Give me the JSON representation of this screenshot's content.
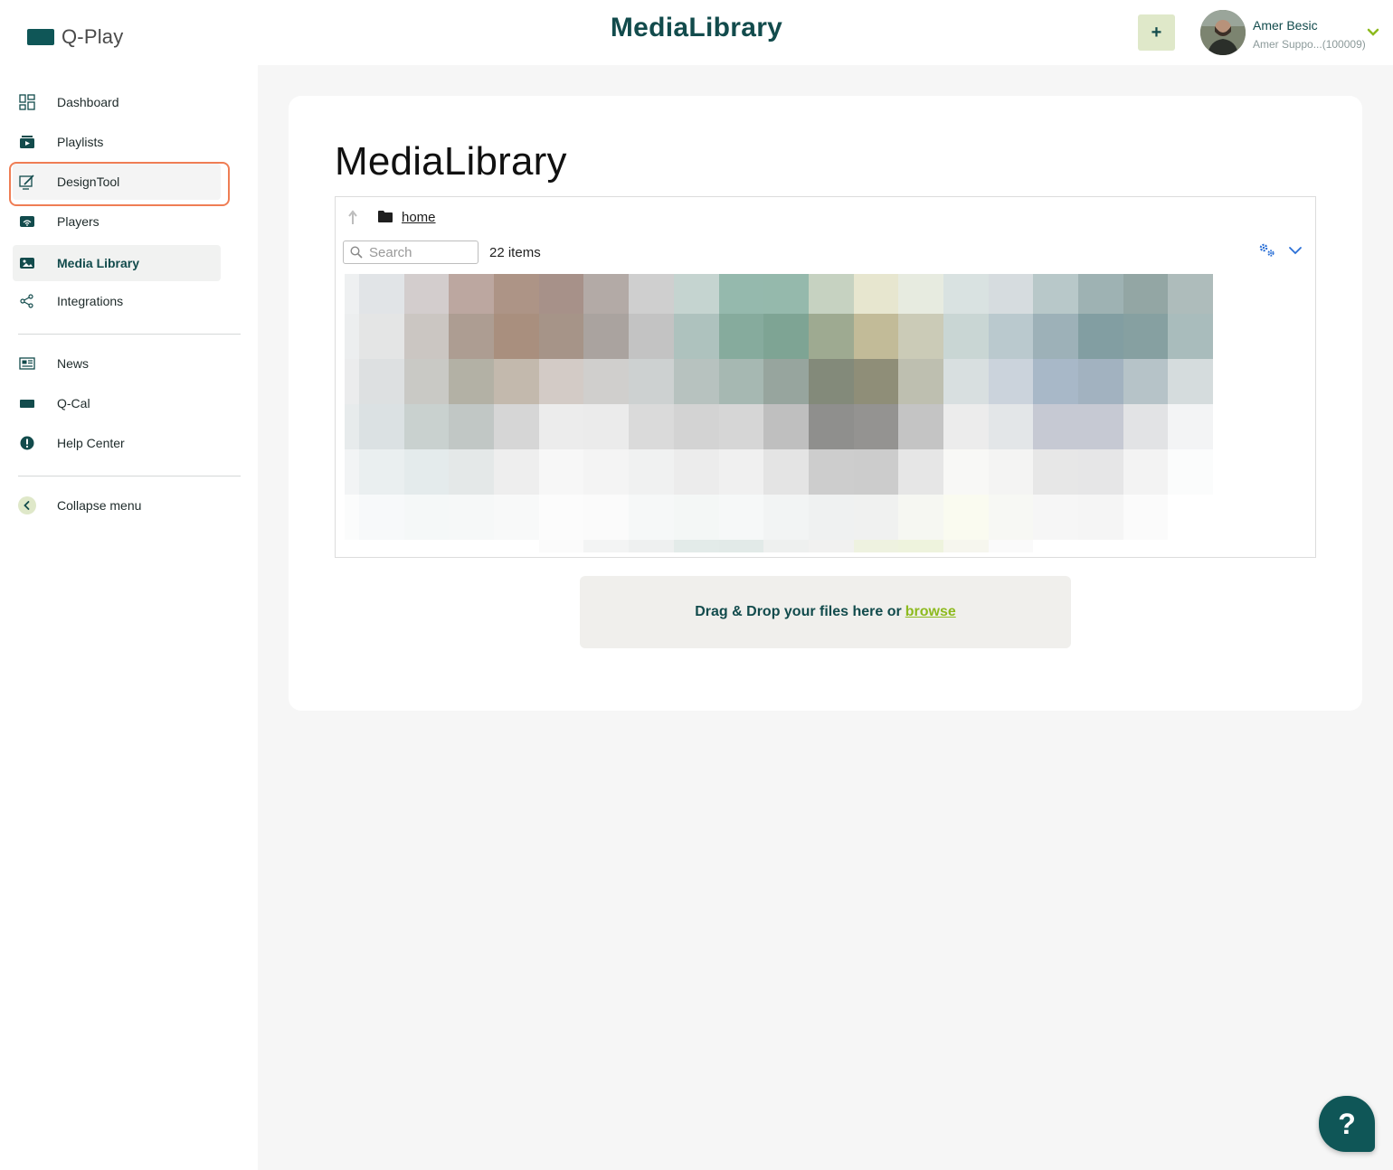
{
  "app": {
    "brand": "Q-Play",
    "page_title": "MediaLibrary"
  },
  "header": {
    "add_label": "+",
    "user": {
      "name": "Amer Besic",
      "org": "Amer Suppo...(100009)"
    }
  },
  "sidebar": {
    "items": [
      {
        "label": "Dashboard",
        "icon": "dashboard-icon"
      },
      {
        "label": "Playlists",
        "icon": "playlist-icon"
      },
      {
        "label": "DesignTool",
        "icon": "design-tool-icon"
      },
      {
        "label": "Players",
        "icon": "player-icon"
      },
      {
        "label": "Media Library",
        "icon": "media-library-icon"
      },
      {
        "label": "Integrations",
        "icon": "share-icon"
      }
    ],
    "secondary": [
      {
        "label": "News",
        "icon": "news-icon"
      },
      {
        "label": "Q-Cal",
        "icon": "calendar-icon"
      },
      {
        "label": "Help Center",
        "icon": "alert-icon"
      }
    ],
    "collapse_label": "Collapse menu"
  },
  "main": {
    "title": "MediaLibrary",
    "breadcrumb": {
      "current": "home"
    },
    "search": {
      "placeholder": "Search",
      "value": ""
    },
    "item_count": "22 items",
    "dropzone": {
      "text": "Drag & Drop your files here or",
      "link": "browse"
    }
  },
  "help_fab": {
    "label": "?"
  },
  "colors": {
    "brand": "#0f5657",
    "accent_green": "#8dba1e",
    "highlight": "#ef7d54",
    "add_button_bg": "#dfe8c9"
  }
}
